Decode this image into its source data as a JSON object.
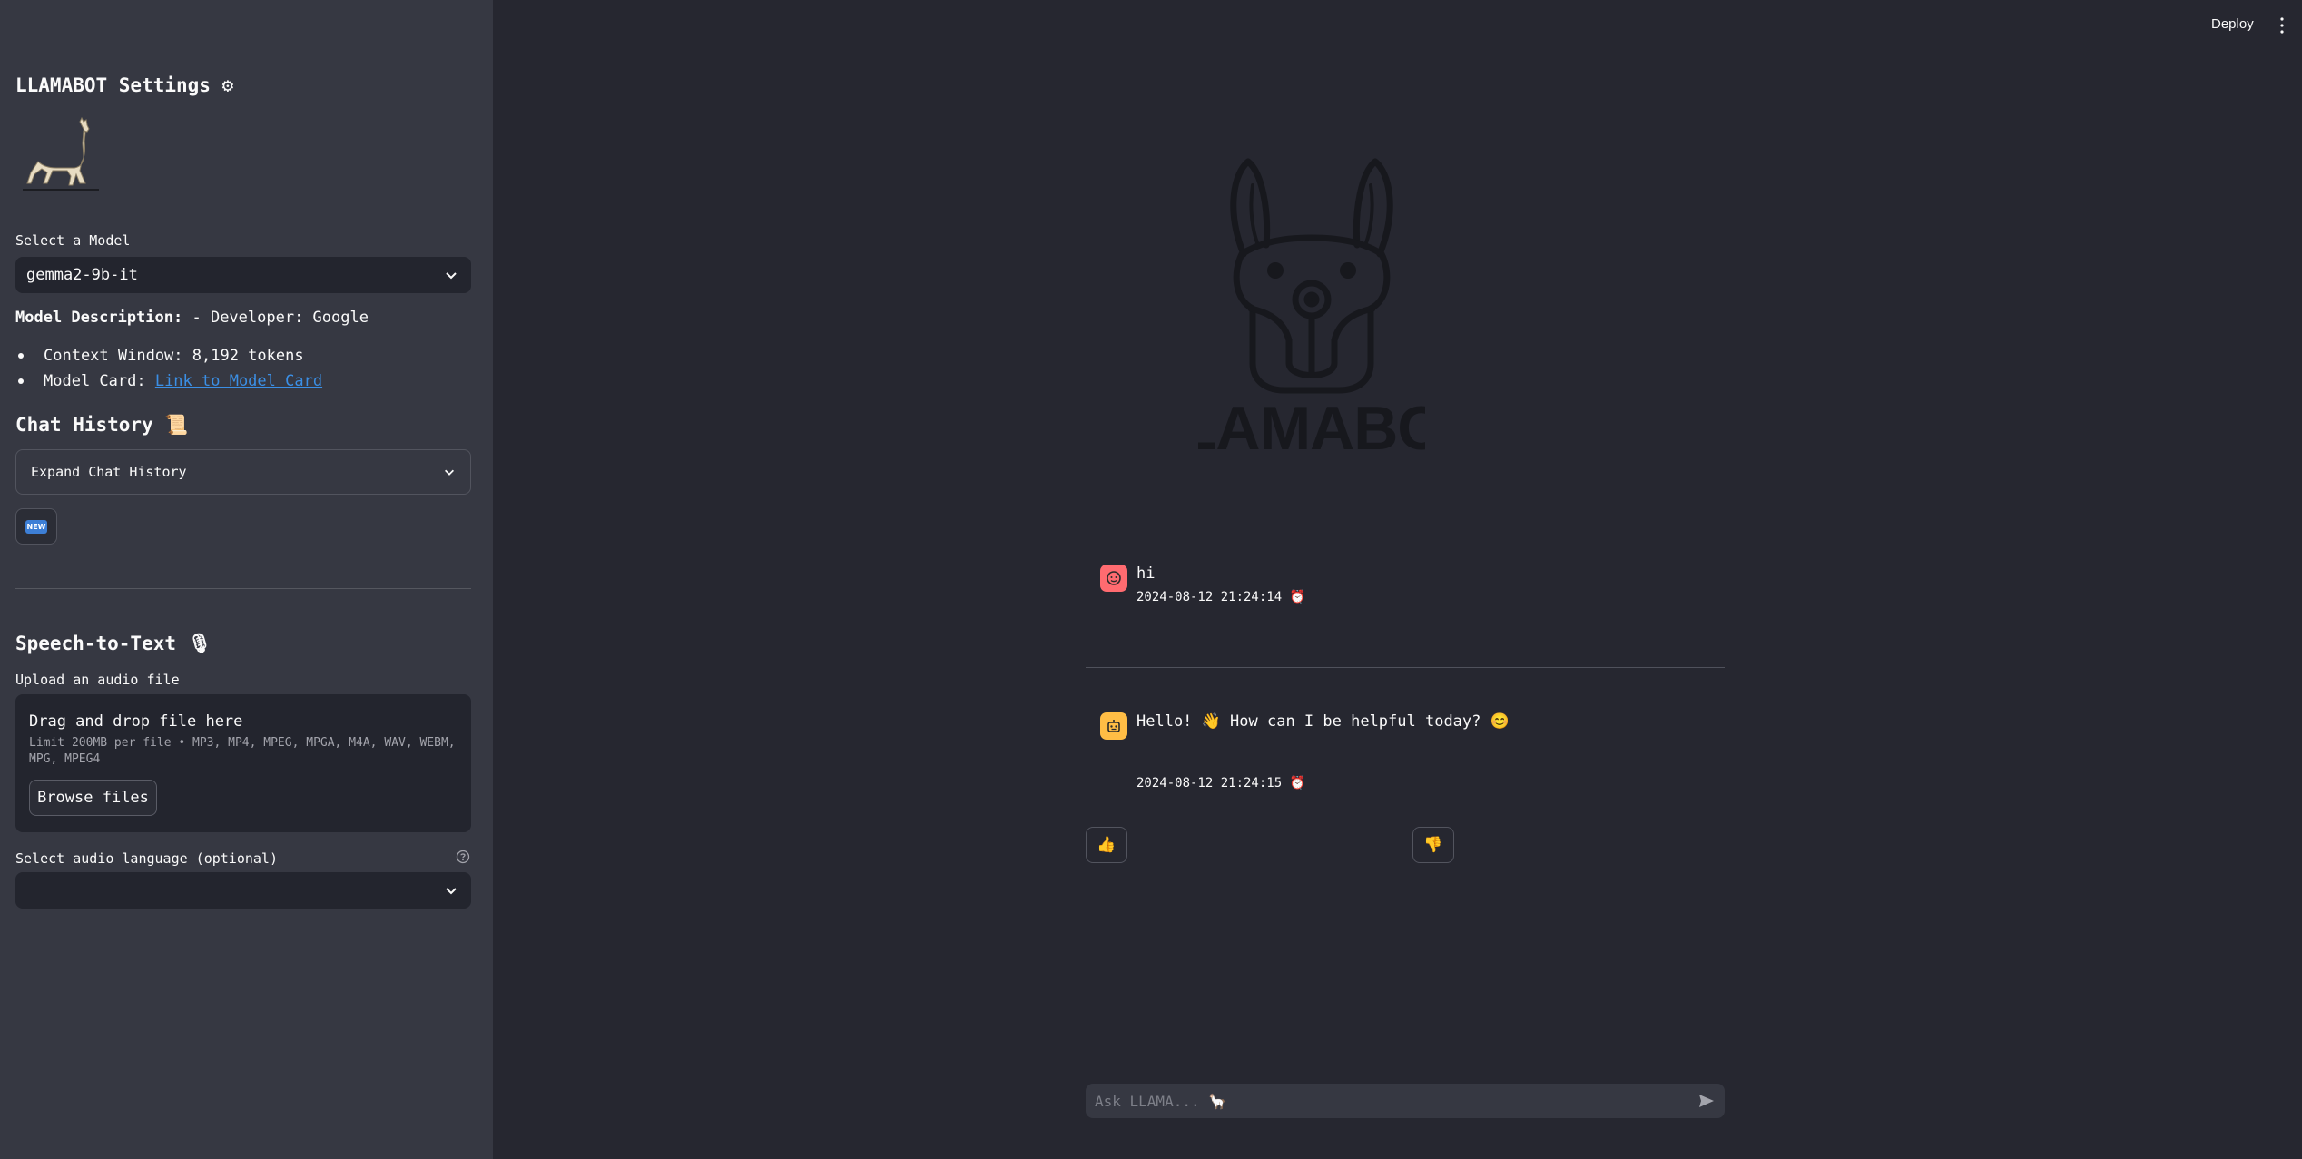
{
  "sidebar": {
    "title": "LLAMABOT Settings ⚙",
    "model_label": "Select a Model",
    "model_value": "gemma2-9b-it",
    "description_label": "Model Description:",
    "description_value": "- Developer: Google",
    "bullets": [
      {
        "label": "Context Window: 8,192 tokens"
      },
      {
        "label": "Model Card: ",
        "link": "Link to Model Card"
      }
    ],
    "chat_history_title": "Chat History 📜",
    "expand_label": "Expand Chat History",
    "new_button": "NEW",
    "speech_title": "Speech-to-Text 🎙",
    "upload_label": "Upload an audio file",
    "upload_title": "Drag and drop file here",
    "upload_limit": "Limit 200MB per file • MP3, MP4, MPEG, MPGA, M4A, WAV, WEBM, MPG, MPEG4",
    "browse_label": "Browse files",
    "language_label": "Select audio language (optional)",
    "language_value": ""
  },
  "header": {
    "deploy_label": "Deploy"
  },
  "chat": {
    "messages": [
      {
        "role": "user",
        "text": "hi",
        "time": "2024-08-12 21:24:14 ⏰"
      },
      {
        "role": "assistant",
        "text": "Hello! 👋 How can I be helpful today? 😊",
        "time": "2024-08-12 21:24:15 ⏰"
      }
    ],
    "thumbs_up": "👍",
    "thumbs_down": "👎",
    "input_placeholder": "Ask LLAMA... 🦙"
  },
  "colors": {
    "background": "#262730",
    "sidebar": "#363842",
    "link": "#3b8fe5",
    "user_avatar": "#ff6b70",
    "bot_avatar": "#ffbd45"
  },
  "icons": [
    "gear-icon",
    "llama-icon",
    "chevron-down-icon",
    "new-badge-icon",
    "microphone-icon",
    "help-icon",
    "kebab-menu-icon",
    "face-icon",
    "robot-icon",
    "thumbs-up-icon",
    "thumbs-down-icon",
    "send-icon"
  ]
}
